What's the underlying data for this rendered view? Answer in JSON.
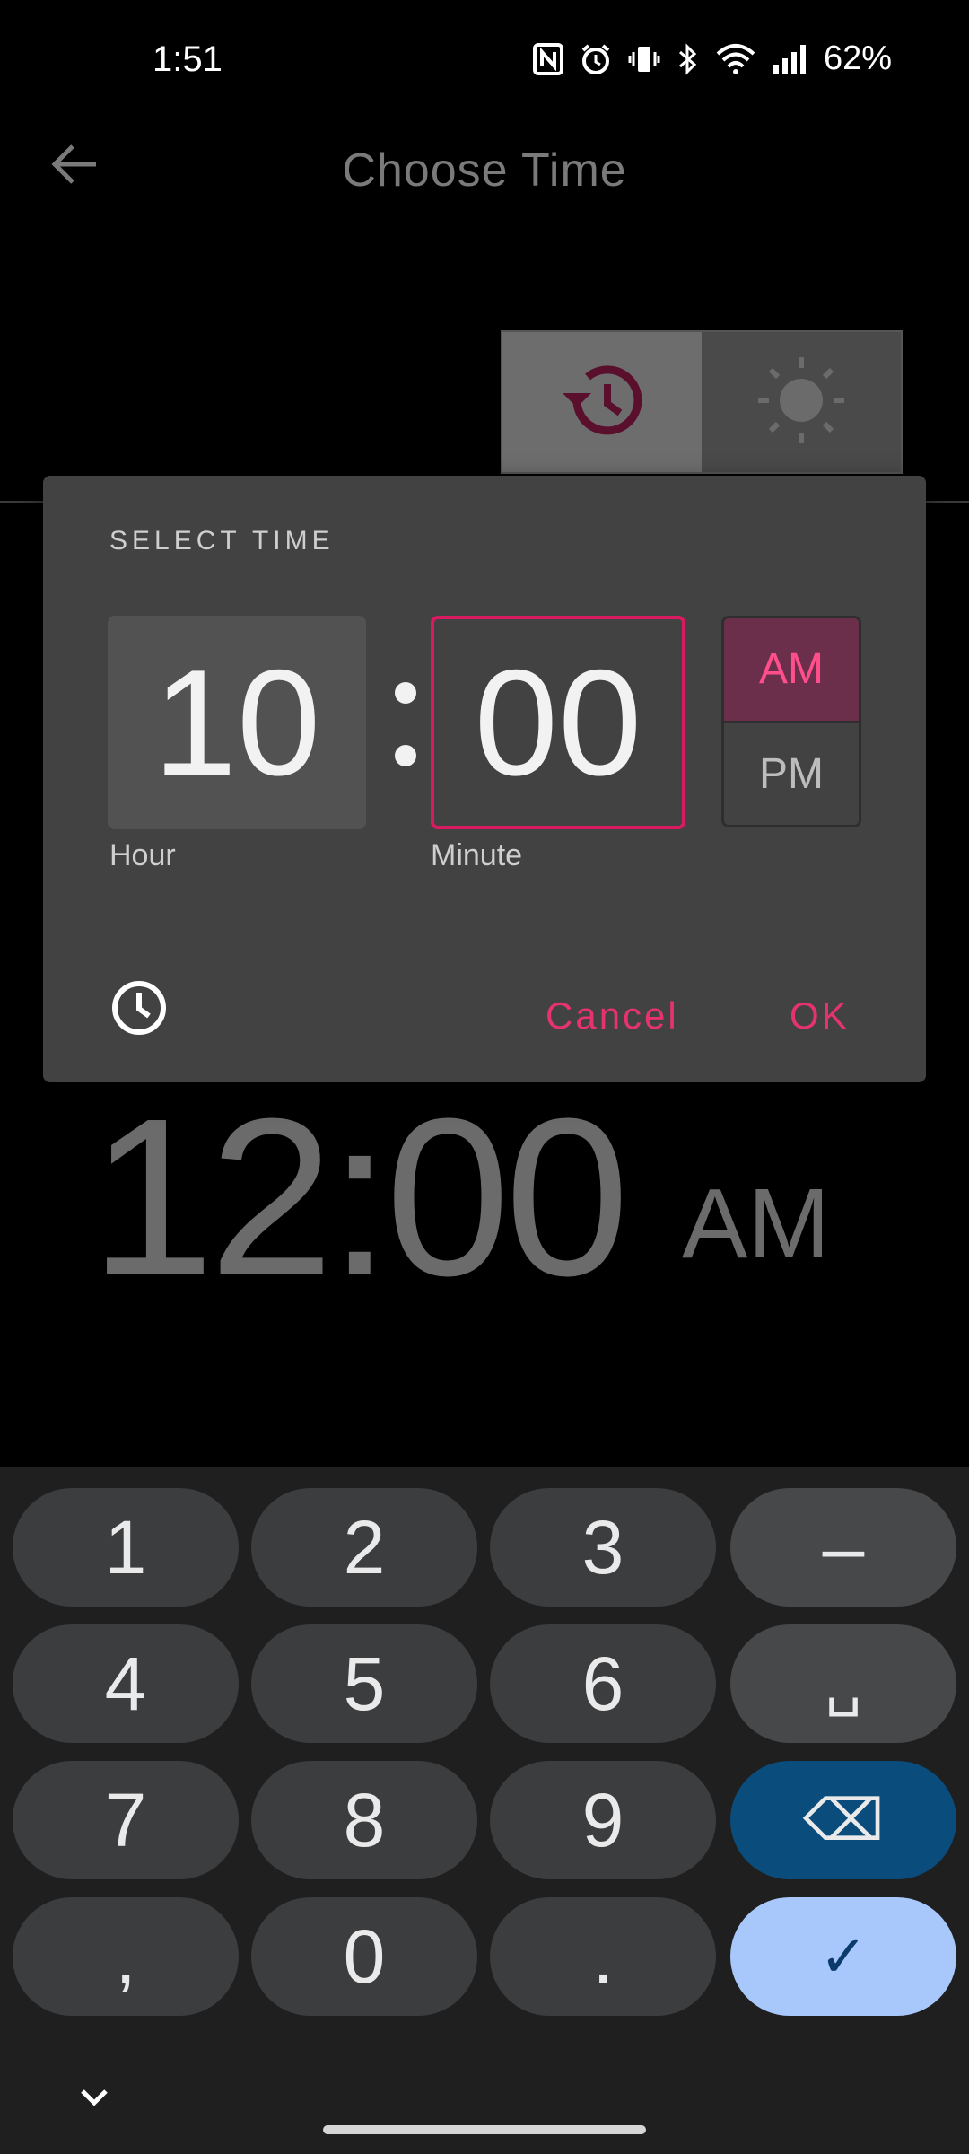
{
  "status_bar": {
    "time": "1:51",
    "battery": "62%"
  },
  "app_bar": {
    "title": "Choose Time"
  },
  "background_clock": {
    "time": "12:00",
    "ampm": "AM"
  },
  "dialog": {
    "title": "SELECT TIME",
    "hour": "10",
    "minute": "00",
    "separator": ":",
    "hour_label": "Hour",
    "minute_label": "Minute",
    "am": "AM",
    "pm": "PM",
    "selected_period": "AM",
    "cancel": "Cancel",
    "ok": "OK"
  },
  "keyboard": {
    "keys": [
      "1",
      "2",
      "3",
      "–",
      "4",
      "5",
      "6",
      "␣",
      "7",
      "8",
      "9",
      "⌫",
      ",",
      "0",
      ".",
      "✓"
    ]
  },
  "colors": {
    "accent": "#e6336e",
    "minute_border": "#d81b60",
    "am_bg": "#6b2f4b",
    "done_key": "#a8c8fb",
    "backspace_key": "#0a4c7c"
  }
}
